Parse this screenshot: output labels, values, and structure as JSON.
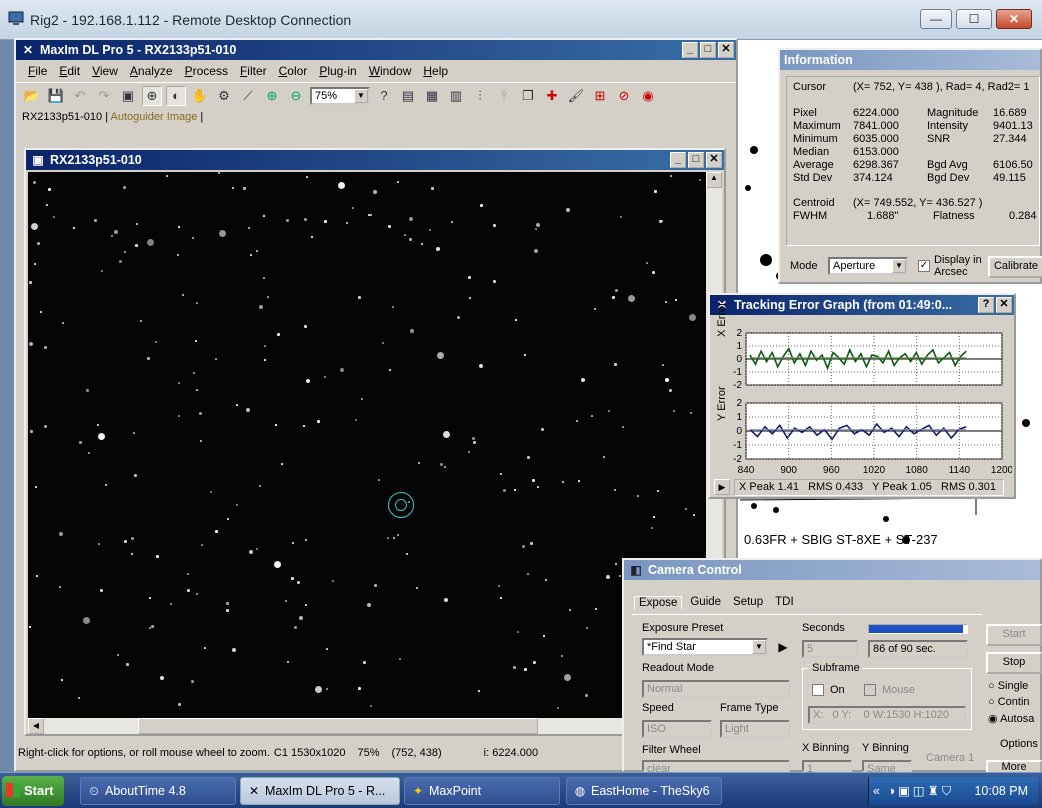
{
  "rdp": {
    "title": "Rig2 - 192.168.1.112 - Remote Desktop Connection",
    "min": "—",
    "max": "☐",
    "close": "✕"
  },
  "maxim": {
    "title": "MaxIm DL Pro 5 - RX2133p51-010",
    "menu": [
      "File",
      "Edit",
      "View",
      "Analyze",
      "Process",
      "Filter",
      "Color",
      "Plug-in",
      "Window",
      "Help"
    ],
    "zoom": "75%",
    "tabs": [
      "RX2133p51-010",
      "Autoguider Image"
    ],
    "image_title": "RX2133p51-010",
    "status": {
      "hint": "Right-click for options, or roll mouse wheel to zoom.",
      "size": "C1 1530x1020",
      "zoom": "75%",
      "coord": "(752, 438)",
      "intensity": "i:  6224.000"
    }
  },
  "info": {
    "title": "Information",
    "cursor_label": "Cursor",
    "cursor_val": "(X=  752, Y=  438 ), Rad=  4, Rad2= 1",
    "rows": [
      [
        "Pixel",
        "6224.000",
        "Magnitude",
        "16.689"
      ],
      [
        "Maximum",
        "7841.000",
        "Intensity",
        "9401.13"
      ],
      [
        "Minimum",
        "6035.000",
        "SNR",
        "27.344"
      ],
      [
        "Median",
        "6153.000",
        "",
        ""
      ],
      [
        "Average",
        "6298.367",
        "Bgd Avg",
        "6106.50"
      ],
      [
        "Std Dev",
        "374.124",
        "Bgd Dev",
        "49.115"
      ]
    ],
    "centroid_label": "Centroid",
    "centroid_val": "(X=  749.552, Y=  436.527 )",
    "fwhm_label": "FWHM",
    "fwhm_val": "1.688\"",
    "flat_label": "Flatness",
    "flat_val": "0.284",
    "mode_label": "Mode",
    "mode_val": "Aperture",
    "arcsec_label": "Display in Arcsec",
    "calibrate": "Calibrate"
  },
  "tracking": {
    "title": "Tracking Error Graph (from 01:49:0...",
    "x_label": "X Error",
    "y_label": "Y Error",
    "y_ticks": [
      "2",
      "1",
      "0",
      "-1",
      "-2"
    ],
    "x_ticks": [
      "840",
      "900",
      "960",
      "1020",
      "1080",
      "1140",
      "1200"
    ],
    "stats": "X Peak 1.41   RMS 0.433   Y Peak 1.05   RMS 0.301"
  },
  "chart_data": [
    {
      "type": "line",
      "xlabel": "",
      "ylabel": "X Error",
      "xlim": [
        840,
        1200
      ],
      "ylim": [
        -2,
        2
      ],
      "series": [
        {
          "values": [
            0.3,
            -0.4,
            0.6,
            -0.2,
            0.5,
            -0.6,
            0.2,
            0.8,
            -0.3,
            0.4,
            -0.5,
            0.6,
            -0.1,
            0.3,
            -0.7,
            0.5,
            0.1,
            -0.4,
            0.7,
            -0.2,
            0.4,
            -0.6,
            0.3,
            0.2,
            -0.3,
            0.6,
            -0.5,
            0.1,
            0.4,
            -0.2,
            0.5,
            -0.4,
            0.3,
            0.7,
            -0.3,
            0.1,
            0.5,
            -0.5,
            0.2,
            0.6
          ]
        }
      ]
    },
    {
      "type": "line",
      "xlabel": "",
      "ylabel": "Y Error",
      "xlim": [
        840,
        1200
      ],
      "ylim": [
        -2,
        2
      ],
      "series": [
        {
          "values": [
            0.1,
            -0.4,
            0.3,
            -0.2,
            0.4,
            -0.5,
            0.2,
            -0.1,
            0.3,
            -0.3,
            0.1,
            -0.6,
            0.2,
            0.4,
            -0.2,
            0.1,
            -0.3,
            0.5,
            -0.1,
            0.2,
            -0.4,
            0.3,
            -0.2,
            0.1,
            0.4,
            -0.3,
            0.2,
            -0.5,
            0.1,
            0.3
          ]
        }
      ]
    }
  ],
  "skychart": {
    "caption": "0.63FR + SBIG ST-8XE + ST-237"
  },
  "camera": {
    "title": "Camera Control",
    "tabs": [
      "Expose",
      "Guide",
      "Setup",
      "TDI"
    ],
    "preset_label": "Exposure Preset",
    "preset_val": "*Find Star",
    "seconds_label": "Seconds",
    "seconds_val": "5",
    "progress_text": "86 of 90 sec.",
    "progress": 0.96,
    "readout_label": "Readout Mode",
    "readout_val": "Normal",
    "subframe_label": "Subframe",
    "on_label": "On",
    "mouse_label": "Mouse",
    "subframe_val": "X:   0 Y:    0 W:1530 H:1020",
    "speed_label": "Speed",
    "speed_val": "ISO",
    "frame_label": "Frame Type",
    "frame_val": "Light",
    "filter_label": "Filter Wheel",
    "filter_val": "clear",
    "xbin_label": "X Binning",
    "ybin_label": "Y Binning",
    "xbin_val": "1",
    "ybin_val": "Same",
    "start": "Start",
    "stop": "Stop",
    "single": "Single",
    "contin": "Contin",
    "autosave": "Autosa",
    "options": "Options",
    "more": "More",
    "camera1": "Camera 1"
  },
  "taskbar": {
    "start": "Start",
    "items": [
      "AboutTime 4.8",
      "MaxIm DL Pro 5 - R...",
      "MaxPoint",
      "EastHome - TheSky6"
    ],
    "clock": "10:08 PM"
  }
}
